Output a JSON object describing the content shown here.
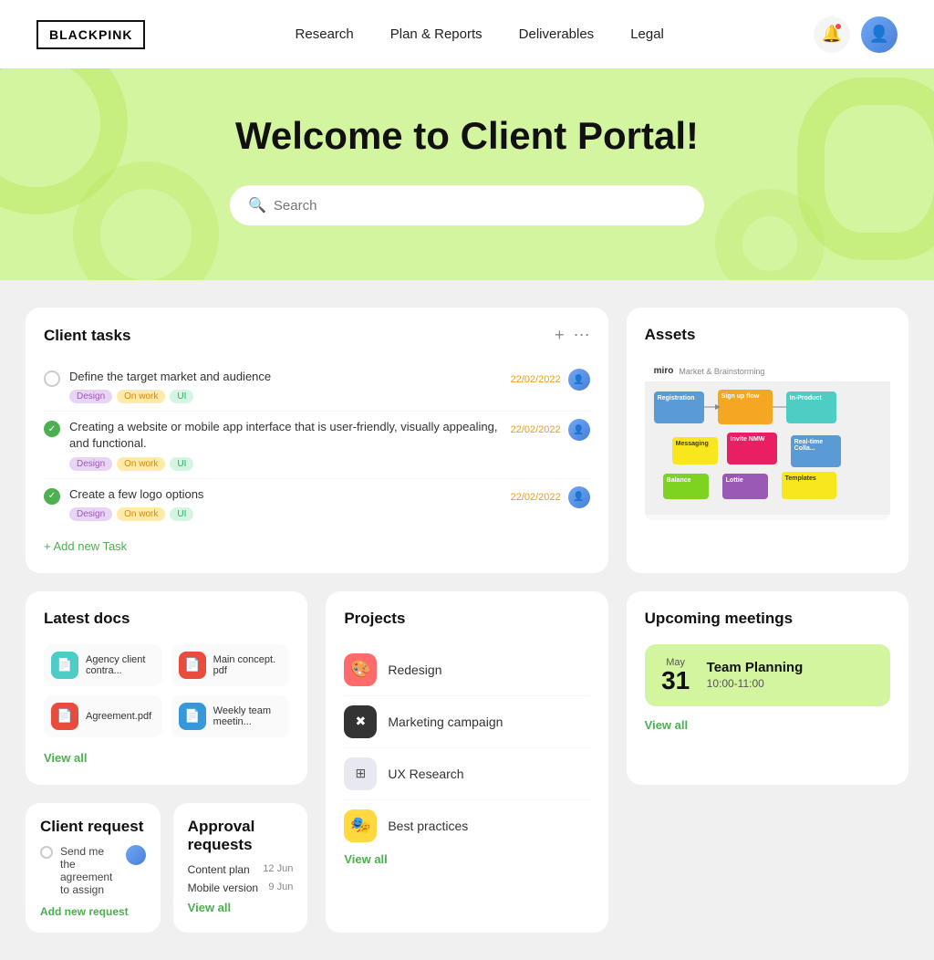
{
  "nav": {
    "logo": "BLACKPINK",
    "links": [
      "Research",
      "Plan & Reports",
      "Deliverables",
      "Legal"
    ]
  },
  "hero": {
    "title": "Welcome to Client Portal!",
    "search_placeholder": "Search"
  },
  "client_tasks": {
    "title": "Client tasks",
    "tasks": [
      {
        "text": "Define the target market and audience",
        "done": false,
        "tags": [
          "Design",
          "On work",
          "UI"
        ],
        "date": "22/02/2022"
      },
      {
        "text": "Creating a website or mobile app interface that is user-friendly, visually appealing, and functional.",
        "done": true,
        "tags": [
          "Design",
          "On work",
          "UI"
        ],
        "date": "22/02/2022"
      },
      {
        "text": "Create a few logo options",
        "done": true,
        "tags": [
          "Design",
          "On work",
          "UI"
        ],
        "date": "22/02/2022"
      }
    ],
    "add_label": "+ Add new Task"
  },
  "assets": {
    "title": "Assets",
    "miro_title": "miro",
    "breadcrumb": "Market & Brainstorming"
  },
  "latest_docs": {
    "title": "Latest docs",
    "docs": [
      {
        "name": "Agency client contra...",
        "icon_type": "teal"
      },
      {
        "name": "Main concept. pdf",
        "icon_type": "red"
      },
      {
        "name": "Agreement.pdf",
        "icon_type": "red"
      },
      {
        "name": "Weekly team meetin...",
        "icon_type": "blue"
      }
    ],
    "view_all": "View all"
  },
  "projects": {
    "title": "Projects",
    "items": [
      {
        "name": "Redesign",
        "icon": "🎨",
        "icon_type": "redesign"
      },
      {
        "name": "Marketing campaign",
        "icon": "✖",
        "icon_type": "marketing"
      },
      {
        "name": "UX Research",
        "icon": "⊞",
        "icon_type": "ux"
      },
      {
        "name": "Best practices",
        "icon": "🎭",
        "icon_type": "best"
      }
    ],
    "view_all": "View all"
  },
  "upcoming_meetings": {
    "title": "Upcoming meetings",
    "meeting": {
      "month": "May",
      "day": "31",
      "name": "Team Planning",
      "time": "10:00-11:00"
    },
    "view_all": "View all"
  },
  "client_request": {
    "title": "Client request",
    "request_text": "Send me the agreement to assign",
    "add_label": "Add new request"
  },
  "approval_requests": {
    "title": "Approval requests",
    "items": [
      {
        "name": "Content plan",
        "date": "12 Jun"
      },
      {
        "name": "Mobile version",
        "date": "9 Jun"
      }
    ],
    "view_all": "View all"
  }
}
